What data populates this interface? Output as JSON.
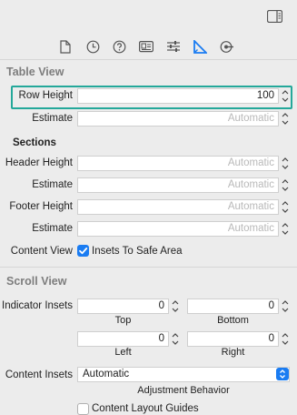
{
  "toolbar": {
    "icons": [
      "file-icon",
      "clock-icon",
      "help-icon",
      "identity-icon",
      "sliders-icon",
      "ruler-icon",
      "connections-icon"
    ],
    "active": "ruler-icon",
    "accent": "#1a7cf2"
  },
  "table_view": {
    "title": "Table View",
    "row_height": {
      "label": "Row Height",
      "value": "100"
    },
    "row_estimate": {
      "label": "Estimate",
      "placeholder": "Automatic"
    },
    "sections_title": "Sections",
    "header_height": {
      "label": "Header Height",
      "placeholder": "Automatic"
    },
    "header_estimate": {
      "label": "Estimate",
      "placeholder": "Automatic"
    },
    "footer_height": {
      "label": "Footer Height",
      "placeholder": "Automatic"
    },
    "footer_estimate": {
      "label": "Estimate",
      "placeholder": "Automatic"
    },
    "content_view": {
      "label": "Content View",
      "checkbox_label": "Insets To Safe Area",
      "checked": true
    }
  },
  "scroll_view": {
    "title": "Scroll View",
    "indicator_insets": {
      "label": "Indicator Insets",
      "top": {
        "value": "0",
        "caption": "Top"
      },
      "bottom": {
        "value": "0",
        "caption": "Bottom"
      },
      "left": {
        "value": "0",
        "caption": "Left"
      },
      "right": {
        "value": "0",
        "caption": "Right"
      }
    },
    "content_insets": {
      "label": "Content Insets",
      "value": "Automatic",
      "caption": "Adjustment Behavior"
    },
    "layout_guides": {
      "label": "Content Layout Guides",
      "checked": false
    }
  },
  "colors": {
    "highlight": "#24a89a",
    "section_title": "#7d7d7d"
  }
}
